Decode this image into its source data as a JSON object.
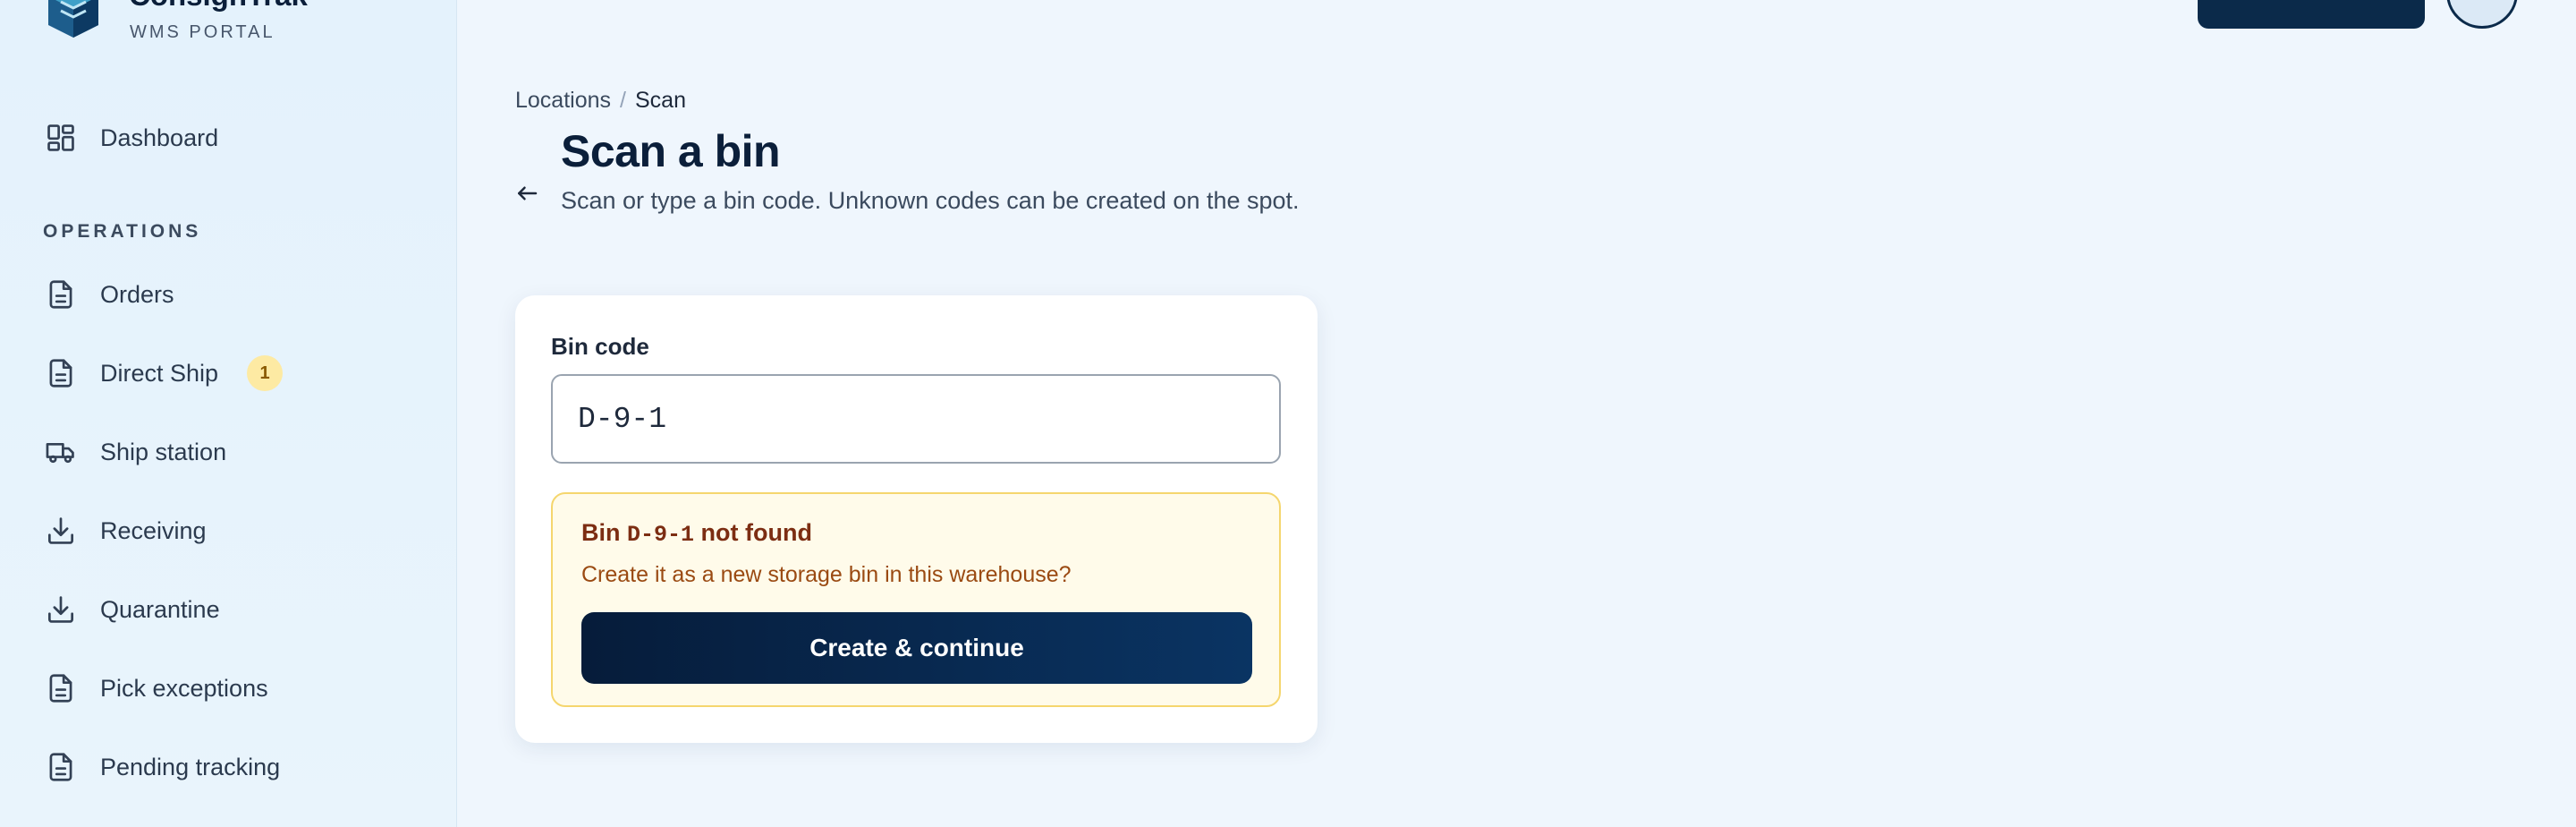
{
  "brand": {
    "name": "ConsignTrak",
    "subtitle": "WMS PORTAL"
  },
  "sidebar": {
    "dashboard": {
      "label": "Dashboard",
      "icon": "grid-icon"
    },
    "section_operations": "OPERATIONS",
    "items": [
      {
        "label": "Orders",
        "icon": "document-icon"
      },
      {
        "label": "Direct Ship",
        "icon": "document-icon",
        "badge": "1"
      },
      {
        "label": "Ship station",
        "icon": "truck-icon"
      },
      {
        "label": "Receiving",
        "icon": "download-icon"
      },
      {
        "label": "Quarantine",
        "icon": "download-icon"
      },
      {
        "label": "Pick exceptions",
        "icon": "document-icon"
      },
      {
        "label": "Pending tracking",
        "icon": "document-icon"
      }
    ]
  },
  "breadcrumb": {
    "parent": "Locations",
    "separator": "/",
    "current": "Scan"
  },
  "page": {
    "title": "Scan a bin",
    "subtitle": "Scan or type a bin code. Unknown codes can be created on the spot."
  },
  "form": {
    "bin_label": "Bin code",
    "bin_value": "D-9-1"
  },
  "alert": {
    "prefix": "Bin",
    "code": "D-9-1",
    "suffix": "not found",
    "message": "Create it as a new storage bin in this warehouse?",
    "button_label": "Create & continue"
  },
  "colors": {
    "primary": "#0b2a4a",
    "alert_bg": "#fffbea",
    "alert_border": "#f5d66e",
    "badge_bg": "#fdeaa3"
  }
}
